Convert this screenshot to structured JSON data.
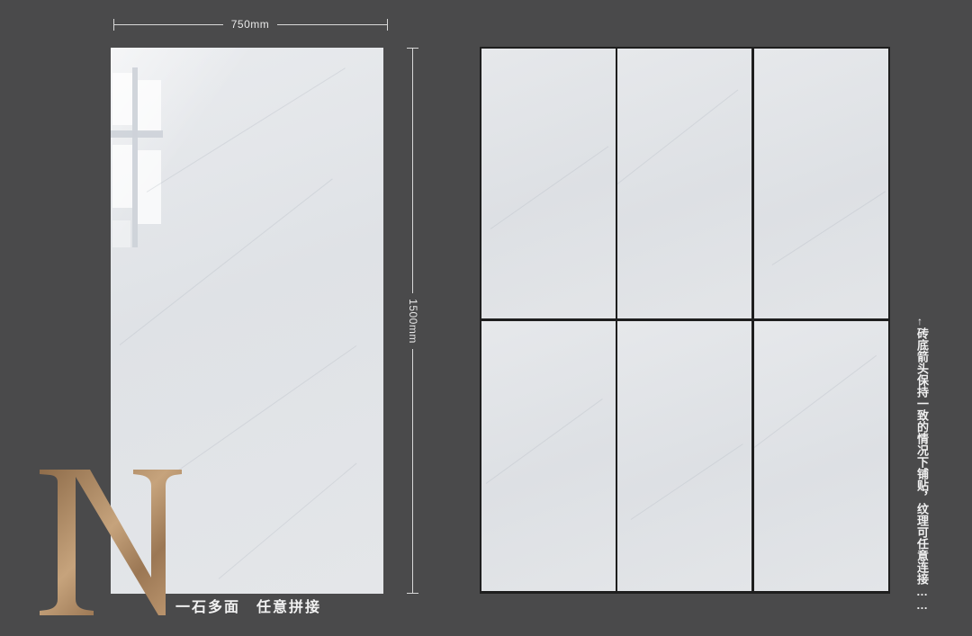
{
  "dimensions": {
    "width_label": "750mm",
    "height_label": "1500mm"
  },
  "slogan": "一石多面　任意拼接",
  "side_note": {
    "arrow": "↑",
    "text": "砖底箭头保持一致的情况下铺贴，纹理可任意连接……"
  },
  "logo": {
    "letter": "N",
    "color": "#b08e6a"
  },
  "colors": {
    "background": "#4a4a4b",
    "tile": "#e2e4e8",
    "grout": "#1e1e1e"
  }
}
